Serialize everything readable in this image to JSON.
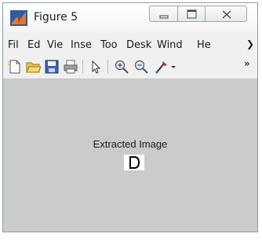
{
  "window": {
    "title": "Figure 5"
  },
  "menu": {
    "items": [
      "Fil",
      "Ed",
      "Vie",
      "Inse",
      "Too",
      "Desk",
      "Wind",
      "He"
    ],
    "overflow_icon": "chevron-right-icon"
  },
  "toolbar": {
    "icons": [
      "new-figure-icon",
      "open-file-icon",
      "save-icon",
      "print-icon",
      "pointer-icon",
      "zoom-in-icon",
      "zoom-out-icon",
      "data-cursor-icon"
    ],
    "overflow_label": "»"
  },
  "figure": {
    "axes_title": "Extracted Image",
    "image_letter_icon": "letter-d-glyph"
  },
  "colors": {
    "figure_background": "#cbcbcb",
    "window_background": "#f0f0f0",
    "app_icon_orange": "#e8771e"
  }
}
